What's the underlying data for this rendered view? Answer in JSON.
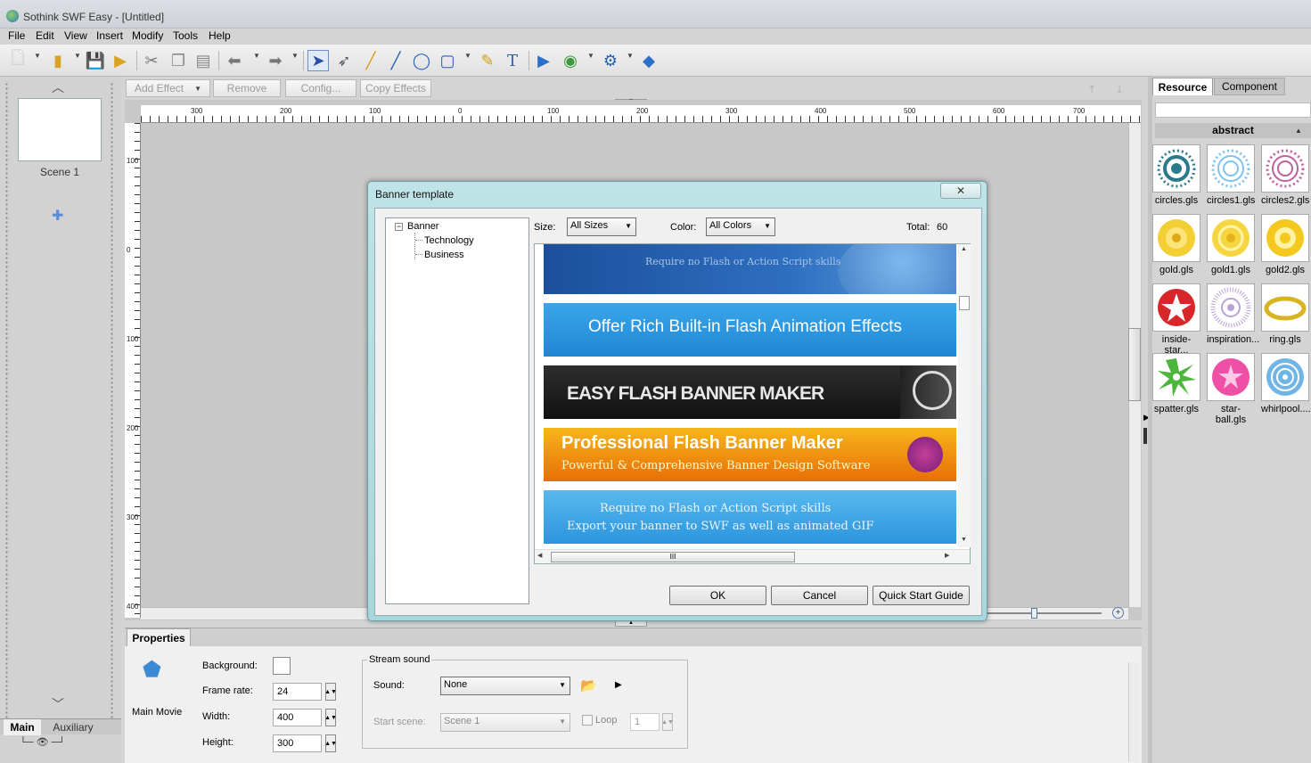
{
  "window": {
    "title": "Sothink SWF Easy - [Untitled]"
  },
  "menu": [
    "File",
    "Edit",
    "View",
    "Insert",
    "Modify",
    "Tools",
    "Help"
  ],
  "effects_toolbar": {
    "add_effect": "Add Effect",
    "remove": "Remove",
    "config": "Config...",
    "copy_effects": "Copy Effects"
  },
  "left_panel": {
    "scene_label": "Scene 1",
    "tabs": [
      "Main",
      "Auxiliary"
    ]
  },
  "ruler": {
    "h_labels": [
      "300",
      "200",
      "100",
      "0",
      "100",
      "200",
      "300",
      "400",
      "500",
      "600",
      "700"
    ],
    "v_labels": [
      "100",
      "0",
      "100",
      "200",
      "300",
      "400"
    ]
  },
  "dialog": {
    "title": "Banner template",
    "close": "✕",
    "tree": {
      "root": "Banner",
      "children": [
        "Technology",
        "Business"
      ]
    },
    "size_label": "Size:",
    "size_value": "All Sizes",
    "color_label": "Color:",
    "color_value": "All Colors",
    "total_label": "Total:",
    "total_value": "60",
    "banners": [
      {
        "text": "Require no Flash or Action Script skills"
      },
      {
        "text": "Offer Rich Built-in Flash Animation Effects"
      },
      {
        "text": "EASY FLASH BANNER MAKER"
      },
      {
        "text": "Professional Flash Banner Maker",
        "sub": "Powerful & Comprehensive Banner Design Software"
      },
      {
        "text": "Require no Flash or Action Script skills",
        "sub": "Export your banner to SWF as well as animated GIF"
      }
    ],
    "scroll_grip": "III",
    "buttons": {
      "ok": "OK",
      "cancel": "Cancel",
      "guide": "Quick Start Guide"
    }
  },
  "right_panel": {
    "tabs": [
      "Resource",
      "Component"
    ],
    "category": "abstract",
    "items": [
      "circles.gls",
      "circles1.gls",
      "circles2.gls",
      "gold.gls",
      "gold1.gls",
      "gold2.gls",
      "inside-star...",
      "inspiration...",
      "ring.gls",
      "spatter.gls",
      "star-ball.gls",
      "whirlpool...."
    ]
  },
  "properties": {
    "tab": "Properties",
    "main_movie": "Main Movie",
    "background_label": "Background:",
    "frame_rate_label": "Frame rate:",
    "frame_rate": "24",
    "width_label": "Width:",
    "width": "400",
    "height_label": "Height:",
    "height": "300",
    "stream_sound": "Stream sound",
    "sound_label": "Sound:",
    "sound_value": "None",
    "start_scene_label": "Start scene:",
    "start_scene_value": "Scene 1",
    "loop_label": "Loop",
    "loop_value": "1"
  }
}
